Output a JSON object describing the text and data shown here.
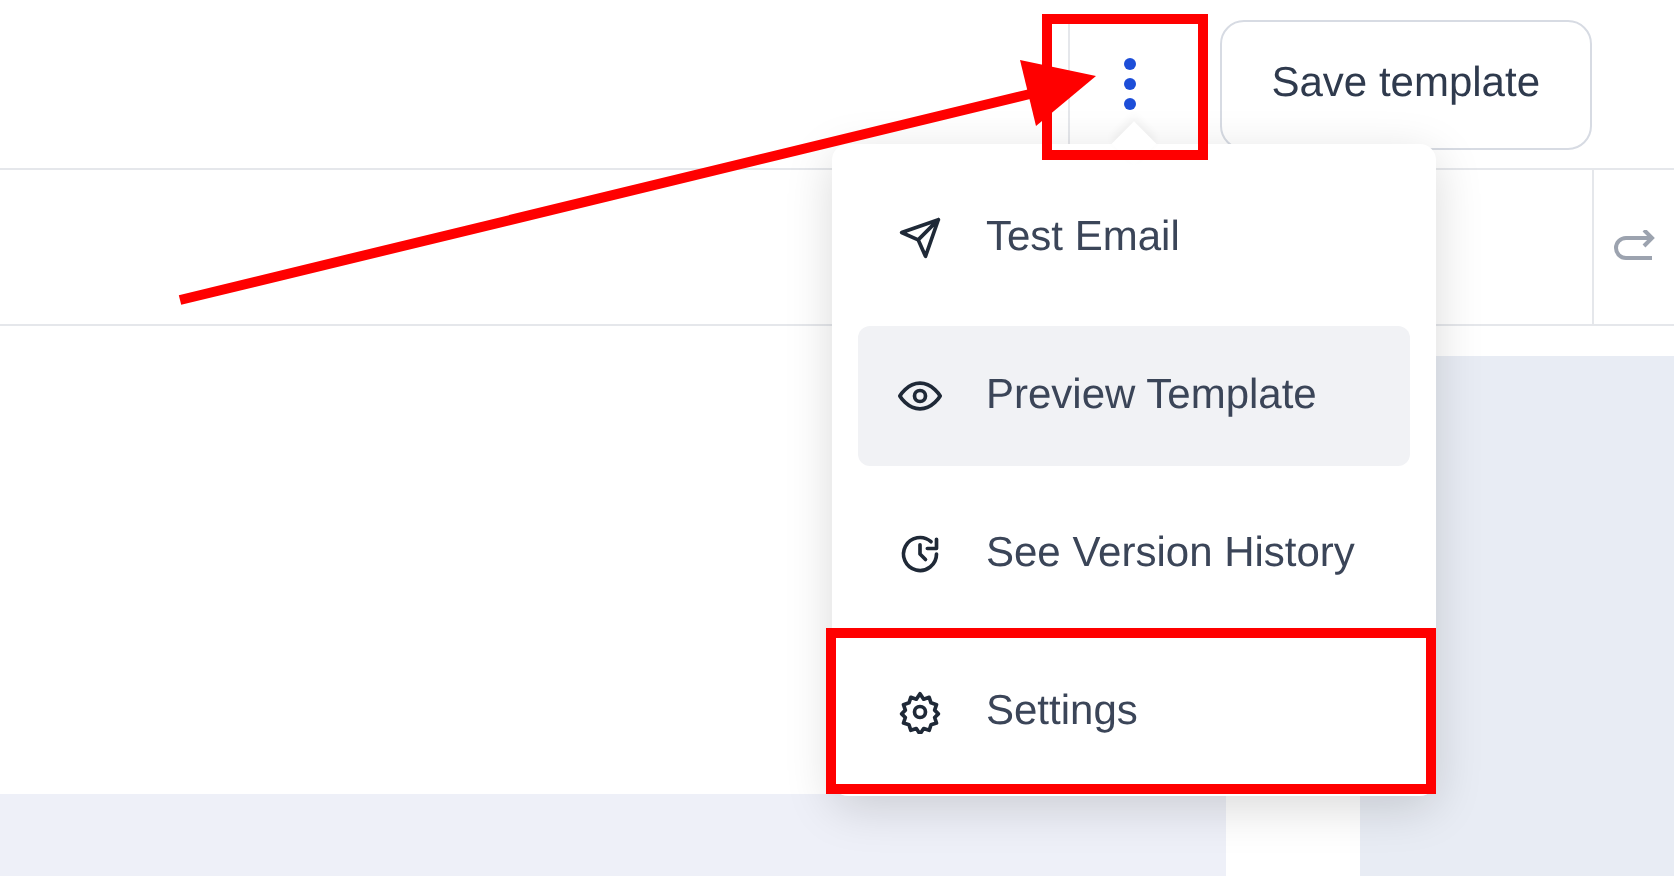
{
  "toolbar": {
    "more_button": {
      "open": true
    },
    "save_button": "Save template"
  },
  "menu": {
    "items": [
      {
        "kind": "send",
        "label": "Test Email",
        "selected": false
      },
      {
        "kind": "preview",
        "label": "Preview Template",
        "selected": true
      },
      {
        "kind": "history",
        "label": "See Version History",
        "selected": false
      },
      {
        "kind": "settings",
        "label": "Settings",
        "selected": false
      }
    ]
  }
}
